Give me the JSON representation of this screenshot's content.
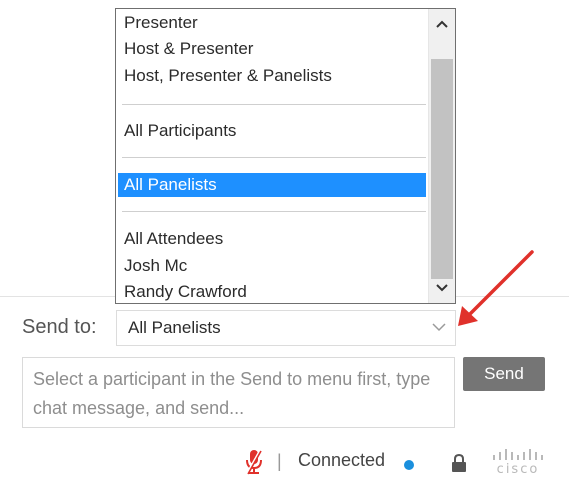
{
  "dropdown": {
    "items": [
      {
        "label": "Presenter"
      },
      {
        "label": "Host & Presenter"
      },
      {
        "label": "Host, Presenter & Panelists"
      },
      {
        "label": "All Participants"
      },
      {
        "label": "All Panelists",
        "selected": true
      },
      {
        "label": "All Attendees"
      },
      {
        "label": "Josh Mc"
      },
      {
        "label": "Randy Crawford"
      }
    ],
    "selected_color": "#1e90ff"
  },
  "send_to": {
    "label": "Send to:",
    "value": "All Panelists"
  },
  "message": {
    "placeholder": "Select a participant in the Send to menu first, type chat message, and send..."
  },
  "send_button": {
    "label": "Send"
  },
  "status": {
    "separator": "|",
    "connection": "Connected",
    "connection_color": "#1a8fdd",
    "mic_color": "#e0312b",
    "logo_text": "cisco"
  },
  "annotation": {
    "arrow_color": "#e0312b"
  }
}
